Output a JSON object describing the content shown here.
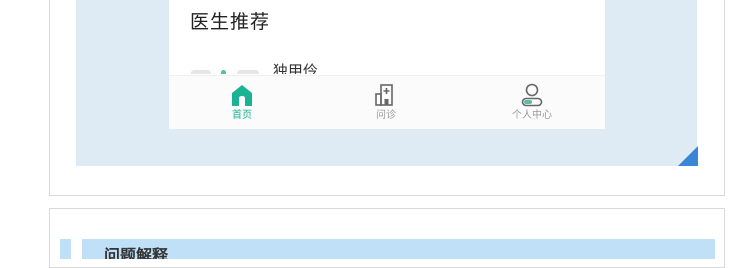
{
  "preview": {
    "section_title": "医生推荐",
    "cut_off_text": "独甲伶"
  },
  "tabbar": {
    "items": [
      {
        "label": "首页",
        "icon": "home-icon",
        "active": true
      },
      {
        "label": "问诊",
        "icon": "hospital-icon",
        "active": false
      },
      {
        "label": "个人中心",
        "icon": "person-icon",
        "active": false
      }
    ]
  },
  "next_section": {
    "title": "问题解释"
  },
  "colors": {
    "accent_active": "#1ab394",
    "preview_background": "#deeaf4",
    "corner_marker": "#3a86d6",
    "section_bar": "#bfe0f7"
  }
}
